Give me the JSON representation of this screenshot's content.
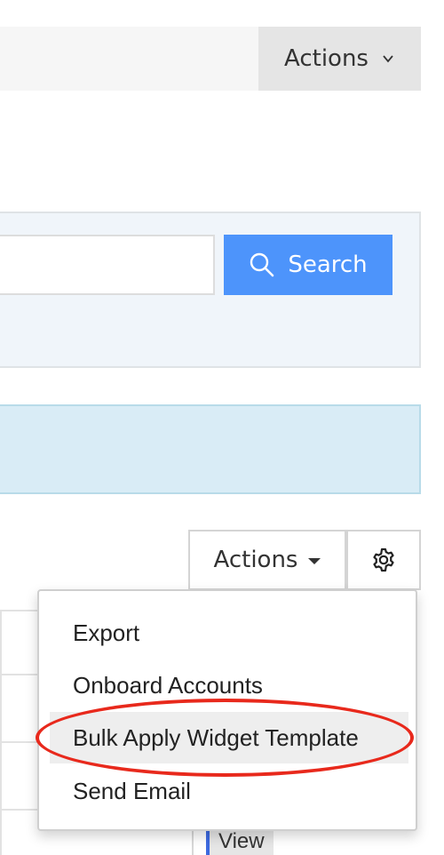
{
  "topbar": {
    "actions_label": "Actions",
    "actions_icon": "chevron-down-icon"
  },
  "search": {
    "placeholder": "",
    "button_label": "Search",
    "button_icon": "search-icon"
  },
  "table_toolbar": {
    "actions_label": "Actions",
    "actions_icon": "caret-down-icon",
    "settings_icon": "gear-icon"
  },
  "actions_menu": {
    "items": [
      {
        "label": "Export"
      },
      {
        "label": "Onboard Accounts"
      },
      {
        "label": "Bulk Apply Widget Template",
        "highlighted": true
      },
      {
        "label": "Send Email"
      }
    ]
  },
  "table": {
    "view_link": "View"
  },
  "colors": {
    "primary": "#4d94fb",
    "annotation": "#e8291c",
    "info_banner": "#d9ecf6",
    "search_panel": "#f0f5fa"
  }
}
